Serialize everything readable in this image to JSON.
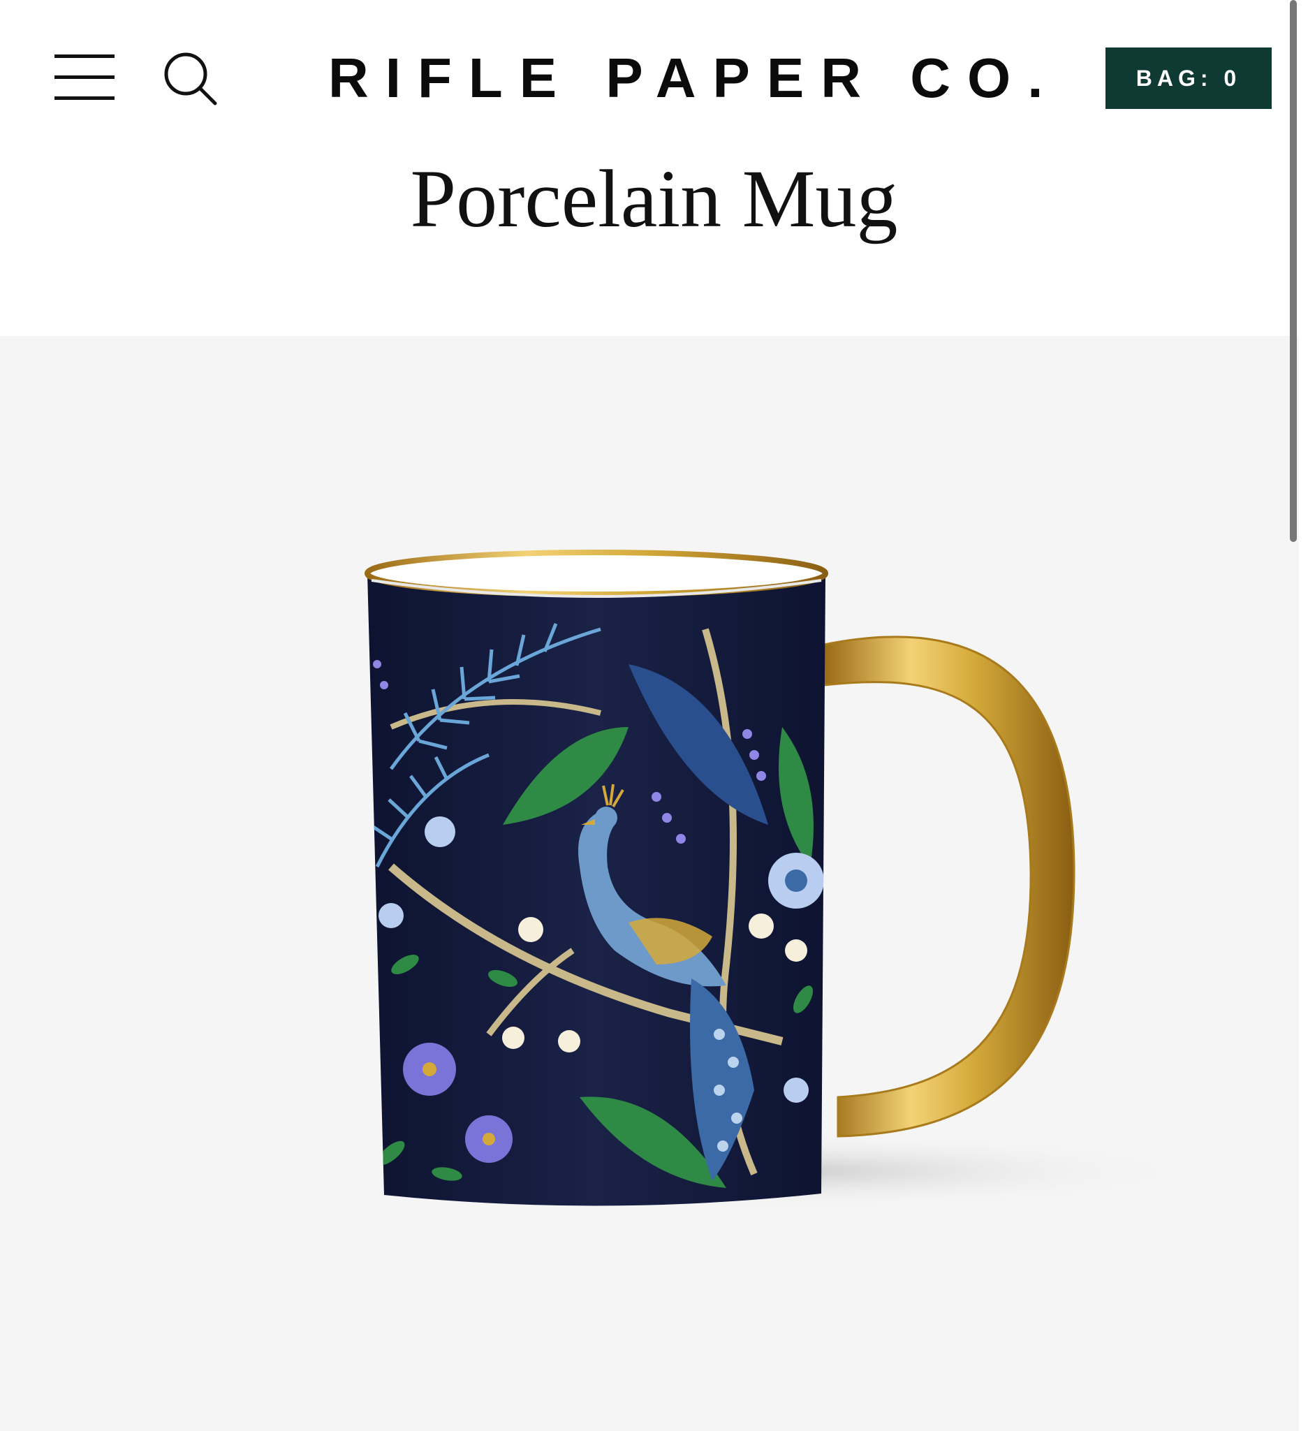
{
  "header": {
    "menu_icon": "hamburger-menu-icon",
    "search_icon": "search-icon",
    "logo_text": "RIFLE PAPER CO.",
    "bag_label": "BAG: 0"
  },
  "product": {
    "title": "Porcelain Mug",
    "image_subject": "navy floral peacock mug with gold handle"
  },
  "colors": {
    "bag_background": "#0f3a33",
    "image_background": "#f5f5f5",
    "mug_navy": "#1a2247",
    "handle_gold": "#d4a93a"
  }
}
